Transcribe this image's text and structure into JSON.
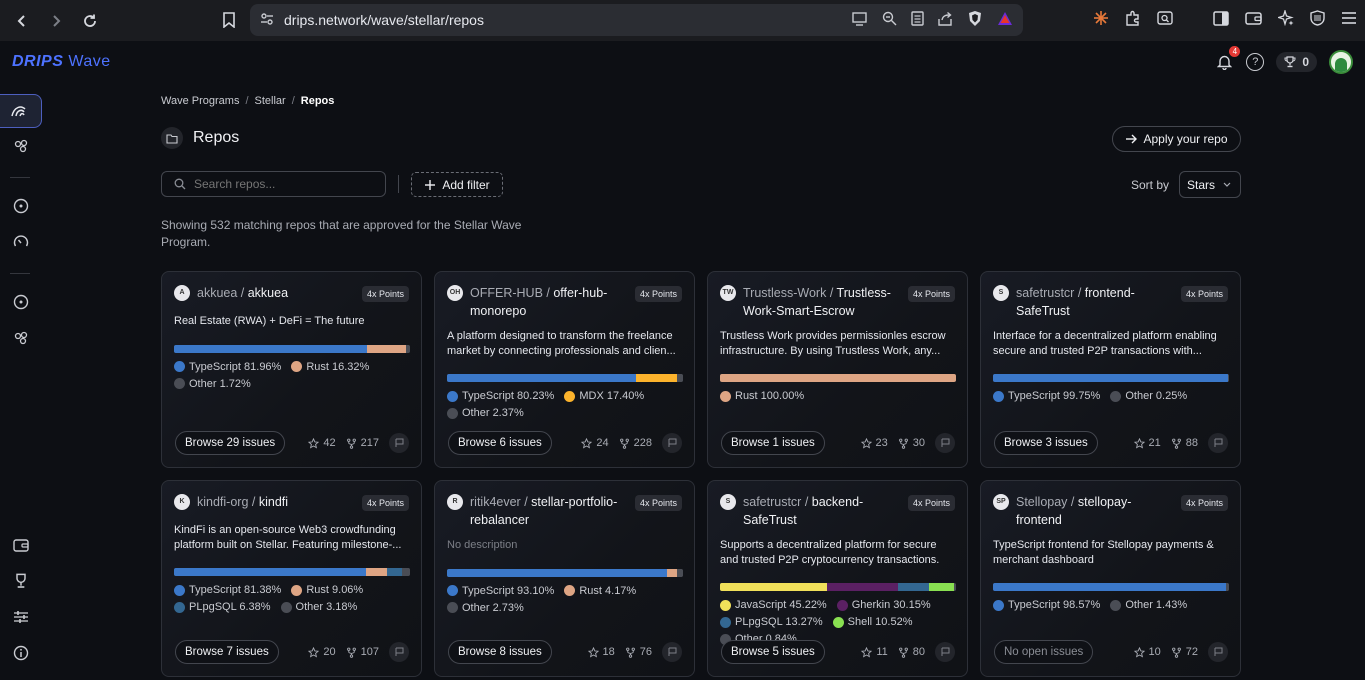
{
  "browser": {
    "url": "drips.network/wave/stellar/repos"
  },
  "app": {
    "logo_bold": "DRIPS",
    "logo_light": "Wave",
    "notifications_count": "4",
    "trophy_count": "0"
  },
  "breadcrumb": {
    "items": [
      "Wave Programs",
      "Stellar",
      "Repos"
    ],
    "separator": "/"
  },
  "page": {
    "title": "Repos",
    "apply_label": "Apply your repo",
    "search_placeholder": "Search repos...",
    "add_filter_label": "Add filter",
    "sort_label": "Sort by",
    "sort_value": "Stars",
    "showing_text": "Showing 532 matching repos that are approved for the Stellar Wave Program."
  },
  "colors": {
    "TypeScript": "#3b78c9",
    "Rust": "#dea584",
    "Other": "#4a4d55",
    "MDX": "#fcb32c",
    "JavaScript": "#f1e05a",
    "Gherkin": "#5b2063",
    "PLpgSQL": "#336791",
    "Shell": "#89e051",
    "accent": "#4d72ff"
  },
  "cards": [
    {
      "owner": "akkuea",
      "sep": " / ",
      "name": "akkuea",
      "points": "4x Points",
      "logo": "A",
      "description": "Real Estate (RWA) + DeFi = The future",
      "no_desc": false,
      "langs": [
        {
          "name": "TypeScript",
          "pct": 81.96,
          "label": "TypeScript 81.96%"
        },
        {
          "name": "Rust",
          "pct": 16.32,
          "label": "Rust 16.32%"
        },
        {
          "name": "Other",
          "pct": 1.72,
          "label": "Other 1.72%"
        }
      ],
      "browse": "Browse 29 issues",
      "browse_disabled": false,
      "stars": "42",
      "forks": "217"
    },
    {
      "owner": "OFFER-HUB",
      "sep": " / ",
      "name": "offer-hub-monorepo",
      "points": "4x Points",
      "logo": "OH",
      "description": "A platform designed to transform the freelance market by connecting professionals and clien...",
      "no_desc": false,
      "langs": [
        {
          "name": "TypeScript",
          "pct": 80.23,
          "label": "TypeScript 80.23%"
        },
        {
          "name": "MDX",
          "pct": 17.4,
          "label": "MDX 17.40%"
        },
        {
          "name": "Other",
          "pct": 2.37,
          "label": "Other 2.37%"
        }
      ],
      "browse": "Browse 6 issues",
      "browse_disabled": false,
      "stars": "24",
      "forks": "228"
    },
    {
      "owner": "Trustless-Work",
      "sep": " / ",
      "name": "Trustless-Work-Smart-Escrow",
      "points": "4x Points",
      "logo": "TW",
      "description": "Trustless Work provides permissionles escrow infrastructure. By using Trustless Work, any...",
      "no_desc": false,
      "langs": [
        {
          "name": "Rust",
          "pct": 100,
          "label": "Rust 100.00%"
        }
      ],
      "browse": "Browse 1 issues",
      "browse_disabled": false,
      "stars": "23",
      "forks": "30"
    },
    {
      "owner": "safetrustcr",
      "sep": " / ",
      "name": "frontend-SafeTrust",
      "points": "4x Points",
      "logo": "S",
      "description": "Interface for a decentralized platform enabling secure and trusted P2P transactions with...",
      "no_desc": false,
      "langs": [
        {
          "name": "TypeScript",
          "pct": 99.75,
          "label": "TypeScript 99.75%"
        },
        {
          "name": "Other",
          "pct": 0.25,
          "label": "Other 0.25%"
        }
      ],
      "browse": "Browse 3 issues",
      "browse_disabled": false,
      "stars": "21",
      "forks": "88"
    },
    {
      "owner": "kindfi-org",
      "sep": " / ",
      "name": "kindfi",
      "points": "4x Points",
      "logo": "K",
      "description": "KindFi is an open-source Web3 crowdfunding platform built on Stellar. Featuring milestone-...",
      "no_desc": false,
      "langs": [
        {
          "name": "TypeScript",
          "pct": 81.38,
          "label": "TypeScript 81.38%"
        },
        {
          "name": "Rust",
          "pct": 9.06,
          "label": "Rust 9.06%"
        },
        {
          "name": "PLpgSQL",
          "pct": 6.38,
          "label": "PLpgSQL 6.38%"
        },
        {
          "name": "Other",
          "pct": 3.18,
          "label": "Other 3.18%"
        }
      ],
      "browse": "Browse 7 issues",
      "browse_disabled": false,
      "stars": "20",
      "forks": "107"
    },
    {
      "owner": "ritik4ever",
      "sep": " / ",
      "name": "stellar-portfolio-rebalancer",
      "points": "4x Points",
      "logo": "R",
      "description": "No description",
      "no_desc": true,
      "langs": [
        {
          "name": "TypeScript",
          "pct": 93.1,
          "label": "TypeScript 93.10%"
        },
        {
          "name": "Rust",
          "pct": 4.17,
          "label": "Rust 4.17%"
        },
        {
          "name": "Other",
          "pct": 2.73,
          "label": "Other 2.73%"
        }
      ],
      "browse": "Browse 8 issues",
      "browse_disabled": false,
      "stars": "18",
      "forks": "76"
    },
    {
      "owner": "safetrustcr",
      "sep": " / ",
      "name": "backend-SafeTrust",
      "points": "4x Points",
      "logo": "S",
      "description": "Supports a decentralized platform for secure and trusted P2P cryptocurrency transactions.",
      "no_desc": false,
      "langs": [
        {
          "name": "JavaScript",
          "pct": 45.22,
          "label": "JavaScript 45.22%"
        },
        {
          "name": "Gherkin",
          "pct": 30.15,
          "label": "Gherkin 30.15%"
        },
        {
          "name": "PLpgSQL",
          "pct": 13.27,
          "label": "PLpgSQL 13.27%"
        },
        {
          "name": "Shell",
          "pct": 10.52,
          "label": "Shell 10.52%"
        },
        {
          "name": "Other",
          "pct": 0.84,
          "label": "Other 0.84%"
        }
      ],
      "browse": "Browse 5 issues",
      "browse_disabled": false,
      "stars": "11",
      "forks": "80"
    },
    {
      "owner": "Stellopay",
      "sep": " / ",
      "name": "stellopay-frontend",
      "points": "4x Points",
      "logo": "SP",
      "description": "TypeScript frontend for Stellopay payments & merchant dashboard",
      "no_desc": false,
      "langs": [
        {
          "name": "TypeScript",
          "pct": 98.57,
          "label": "TypeScript 98.57%"
        },
        {
          "name": "Other",
          "pct": 1.43,
          "label": "Other 1.43%"
        }
      ],
      "browse": "No open issues",
      "browse_disabled": true,
      "stars": "10",
      "forks": "72"
    }
  ]
}
